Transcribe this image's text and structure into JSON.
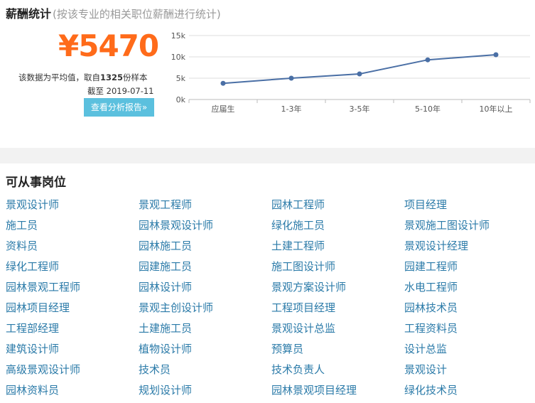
{
  "salary": {
    "title": "薪酬统计",
    "subtitle": "(按该专业的相关职位薪酬进行统计)",
    "amount": "¥5470",
    "note_prefix": "该数据为平均值，取自",
    "sample_count": "1325",
    "note_suffix": "份样本",
    "date_line": "截至 2019-07-11",
    "button_label": "查看分析报告»"
  },
  "chart_data": {
    "type": "line",
    "categories": [
      "应届生",
      "1-3年",
      "3-5年",
      "5-10年",
      "10年以上"
    ],
    "values": [
      3800,
      5000,
      6000,
      9300,
      10500
    ],
    "yticks": [
      "0k",
      "5k",
      "10k",
      "15k"
    ],
    "ylim": [
      0,
      15000
    ],
    "title": "",
    "xlabel": "",
    "ylabel": "",
    "grid": true,
    "color": "#4a6fa5"
  },
  "jobs": {
    "title": "可从事岗位",
    "items": [
      "景观设计师",
      "景观工程师",
      "园林工程师",
      "项目经理",
      "施工员",
      "园林景观设计师",
      "绿化施工员",
      "景观施工图设计师",
      "资料员",
      "园林施工员",
      "土建工程师",
      "景观设计经理",
      "绿化工程师",
      "园建施工员",
      "施工图设计师",
      "园建工程师",
      "园林景观工程师",
      "园林设计师",
      "景观方案设计师",
      "水电工程师",
      "园林项目经理",
      "景观主创设计师",
      "工程项目经理",
      "园林技术员",
      "工程部经理",
      "土建施工员",
      "景观设计总监",
      "工程资料员",
      "建筑设计师",
      "植物设计师",
      "预算员",
      "设计总监",
      "高级景观设计师",
      "技术员",
      "技术负责人",
      "景观设计",
      "园林资料员",
      "规划设计师",
      "园林景观项目经理",
      "绿化技术员"
    ]
  }
}
